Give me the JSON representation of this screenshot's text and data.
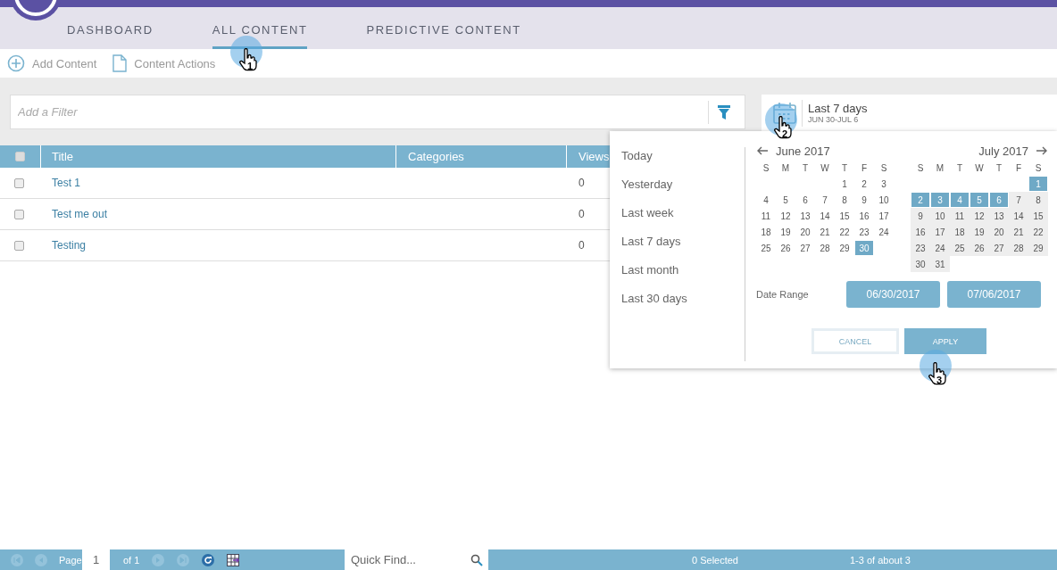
{
  "nav": {
    "tabs": [
      {
        "label": "DASHBOARD",
        "selected": false
      },
      {
        "label": "ALL CONTENT",
        "selected": true
      },
      {
        "label": "PREDICTIVE CONTENT",
        "selected": false
      }
    ]
  },
  "toolbar": {
    "actions": [
      {
        "kind": "add",
        "label": "Add Content"
      },
      {
        "kind": "document",
        "label": "Content Actions"
      }
    ]
  },
  "filter": {
    "placeholder": "Add a Filter"
  },
  "date_picker": {
    "title": "Last 7 days",
    "subtitle": "JUN 30-JUL 6"
  },
  "table": {
    "columns": [
      "Title",
      "Categories",
      "Views"
    ],
    "select_all": false,
    "rows": [
      {
        "checked": false,
        "title": "Test 1",
        "views": "0"
      },
      {
        "checked": false,
        "title": "Test me out",
        "views": "0"
      },
      {
        "checked": false,
        "title": "Testing",
        "views": "0"
      }
    ]
  },
  "popup": {
    "presets": [
      "Today",
      "Yesterday",
      "Last week",
      "Last 7 days",
      "Last month",
      "Last 30 days"
    ],
    "months": [
      {
        "title": "June 2017",
        "weekdays": [
          "S",
          "M",
          "T",
          "W",
          "T",
          "F",
          "S"
        ],
        "weeks": [
          {
            "days": [
              {
                "day": "1",
                "selected": false,
                "disabled": false
              },
              {
                "day": "2",
                "selected": false,
                "disabled": false
              },
              {
                "day": "3",
                "selected": false,
                "disabled": false
              }
            ]
          },
          {
            "days": [
              {
                "day": "4",
                "selected": false,
                "disabled": false
              },
              {
                "day": "5",
                "selected": false,
                "disabled": false
              },
              {
                "day": "6",
                "selected": false,
                "disabled": false
              },
              {
                "day": "7",
                "selected": false,
                "disabled": false
              },
              {
                "day": "8",
                "selected": false,
                "disabled": false
              },
              {
                "day": "9",
                "selected": false,
                "disabled": false
              },
              {
                "day": "10",
                "selected": false,
                "disabled": false
              }
            ]
          },
          {
            "days": [
              {
                "day": "11",
                "selected": false,
                "disabled": false
              },
              {
                "day": "12",
                "selected": false,
                "disabled": false
              },
              {
                "day": "13",
                "selected": false,
                "disabled": false
              },
              {
                "day": "14",
                "selected": false,
                "disabled": false
              },
              {
                "day": "15",
                "selected": false,
                "disabled": false
              },
              {
                "day": "16",
                "selected": false,
                "disabled": false
              },
              {
                "day": "17",
                "selected": false,
                "disabled": false
              }
            ]
          },
          {
            "days": [
              {
                "day": "18",
                "selected": false,
                "disabled": false
              },
              {
                "day": "19",
                "selected": false,
                "disabled": false
              },
              {
                "day": "20",
                "selected": false,
                "disabled": false
              },
              {
                "day": "21",
                "selected": false,
                "disabled": false
              },
              {
                "day": "22",
                "selected": false,
                "disabled": false
              },
              {
                "day": "23",
                "selected": false,
                "disabled": false
              },
              {
                "day": "24",
                "selected": false,
                "disabled": false
              }
            ]
          },
          {
            "days": [
              {
                "day": "25",
                "selected": false,
                "disabled": false
              },
              {
                "day": "26",
                "selected": false,
                "disabled": false
              },
              {
                "day": "27",
                "selected": false,
                "disabled": false
              },
              {
                "day": "28",
                "selected": false,
                "disabled": false
              },
              {
                "day": "29",
                "selected": false,
                "disabled": false
              },
              {
                "day": "30",
                "selected": true,
                "disabled": false
              }
            ]
          }
        ]
      },
      {
        "title": "July 2017",
        "weekdays": [
          "S",
          "M",
          "T",
          "W",
          "T",
          "F",
          "S"
        ],
        "weeks": [
          {
            "days": [
              {
                "day": "1",
                "selected": true,
                "disabled": false
              }
            ]
          },
          {
            "days": [
              {
                "day": "2",
                "selected": true,
                "disabled": false
              },
              {
                "day": "3",
                "selected": true,
                "disabled": false
              },
              {
                "day": "4",
                "selected": true,
                "disabled": false
              },
              {
                "day": "5",
                "selected": true,
                "disabled": false
              },
              {
                "day": "6",
                "selected": true,
                "disabled": false
              },
              {
                "day": "7",
                "selected": false,
                "disabled": true
              },
              {
                "day": "8",
                "selected": false,
                "disabled": true
              }
            ]
          },
          {
            "days": [
              {
                "day": "9",
                "selected": false,
                "disabled": true
              },
              {
                "day": "10",
                "selected": false,
                "disabled": true
              },
              {
                "day": "11",
                "selected": false,
                "disabled": true
              },
              {
                "day": "12",
                "selected": false,
                "disabled": true
              },
              {
                "day": "13",
                "selected": false,
                "disabled": true
              },
              {
                "day": "14",
                "selected": false,
                "disabled": true
              },
              {
                "day": "15",
                "selected": false,
                "disabled": true
              }
            ]
          },
          {
            "days": [
              {
                "day": "16",
                "selected": false,
                "disabled": true
              },
              {
                "day": "17",
                "selected": false,
                "disabled": true
              },
              {
                "day": "18",
                "selected": false,
                "disabled": true
              },
              {
                "day": "19",
                "selected": false,
                "disabled": true
              },
              {
                "day": "20",
                "selected": false,
                "disabled": true
              },
              {
                "day": "21",
                "selected": false,
                "disabled": true
              },
              {
                "day": "22",
                "selected": false,
                "disabled": true
              }
            ]
          },
          {
            "days": [
              {
                "day": "23",
                "selected": false,
                "disabled": true
              },
              {
                "day": "24",
                "selected": false,
                "disabled": true
              },
              {
                "day": "25",
                "selected": false,
                "disabled": true
              },
              {
                "day": "26",
                "selected": false,
                "disabled": true
              },
              {
                "day": "27",
                "selected": false,
                "disabled": true
              },
              {
                "day": "28",
                "selected": false,
                "disabled": true
              },
              {
                "day": "29",
                "selected": false,
                "disabled": true
              }
            ]
          },
          {
            "days": [
              {
                "day": "30",
                "selected": false,
                "disabled": true
              },
              {
                "day": "31",
                "selected": false,
                "disabled": true
              }
            ]
          }
        ]
      }
    ],
    "range_label": "Date Range",
    "range_start": "06/30/2017",
    "range_end": "07/06/2017",
    "buttons": [
      {
        "kind": "cancel",
        "label": "CANCEL"
      },
      {
        "kind": "apply",
        "label": "APPLY"
      }
    ]
  },
  "pager": {
    "page_label": "Page",
    "page": "1",
    "of": "of 1",
    "quick_find_placeholder": "Quick Find...",
    "selected": "0 Selected",
    "count": "1-3 of about 3"
  },
  "tutorial_steps": [
    {
      "number": "1"
    },
    {
      "number": "2"
    },
    {
      "number": "3"
    }
  ]
}
